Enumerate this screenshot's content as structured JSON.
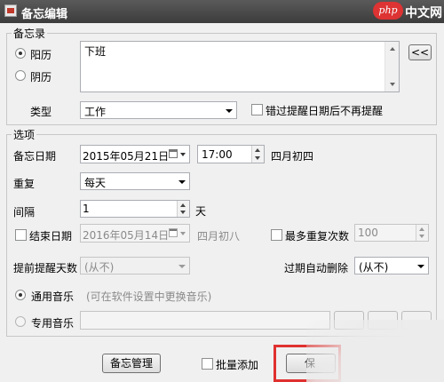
{
  "window": {
    "title": "备忘编辑"
  },
  "watermark": {
    "logo": "php",
    "text": "中文网"
  },
  "memo_group": {
    "label": "备忘录",
    "solar_label": "阳历",
    "lunar_label": "阴历",
    "content": "下班",
    "collapse_label": "<<",
    "type_label": "类型",
    "type_value": "工作",
    "no_remind_after_missed_label": "错过提醒日期后不再提醒"
  },
  "options_group": {
    "label": "选项",
    "date_label": "备忘日期",
    "date_value": "2015年05月21日",
    "time_value": "17:00",
    "lunar_date": "四月初四",
    "repeat_label": "重复",
    "repeat_value": "每天",
    "interval_label": "间隔",
    "interval_value": "1",
    "interval_unit": "天",
    "end_date_label": "结束日期",
    "end_date_value": "2016年05月14日",
    "end_lunar_date": "四月初八",
    "max_repeat_label": "最多重复次数",
    "max_repeat_value": "100",
    "advance_days_label": "提前提醒天数",
    "advance_days_value": "(从不)",
    "auto_delete_label": "过期自动删除",
    "auto_delete_value": "(从不)",
    "general_music_label": "通用音乐",
    "general_music_hint": "(可在软件设置中更换音乐)",
    "custom_music_label": "专用音乐"
  },
  "footer": {
    "manage_button": "备忘管理",
    "batch_add_label": "批量添加",
    "ok_button": "保"
  }
}
